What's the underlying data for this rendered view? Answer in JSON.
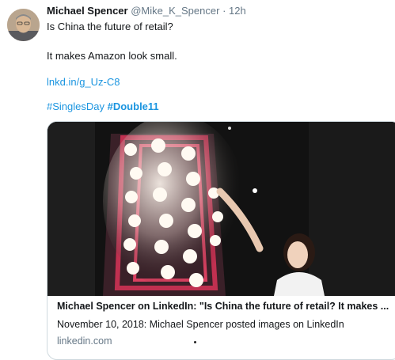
{
  "tweet": {
    "author_name": "Michael Spencer",
    "handle": "@Mike_K_Spencer",
    "separator": "·",
    "time": "12h",
    "lines": [
      "Is China the future of retail?",
      "It makes Amazon look small."
    ],
    "link": "lnkd.in/g_Uz-C8",
    "hashtags": [
      "#SinglesDay",
      "#Double11"
    ]
  },
  "card": {
    "title": "Michael Spencer on LinkedIn: \"Is China the future of retail? It makes ...",
    "description": "November 10, 2018: Michael Spencer posted images on LinkedIn",
    "domain": "linkedin.com"
  },
  "colors": {
    "link": "#1b95e0",
    "secondary_text": "#657786",
    "card_border": "#cfd9de"
  },
  "icons": {
    "avatar": "profile-photo"
  }
}
